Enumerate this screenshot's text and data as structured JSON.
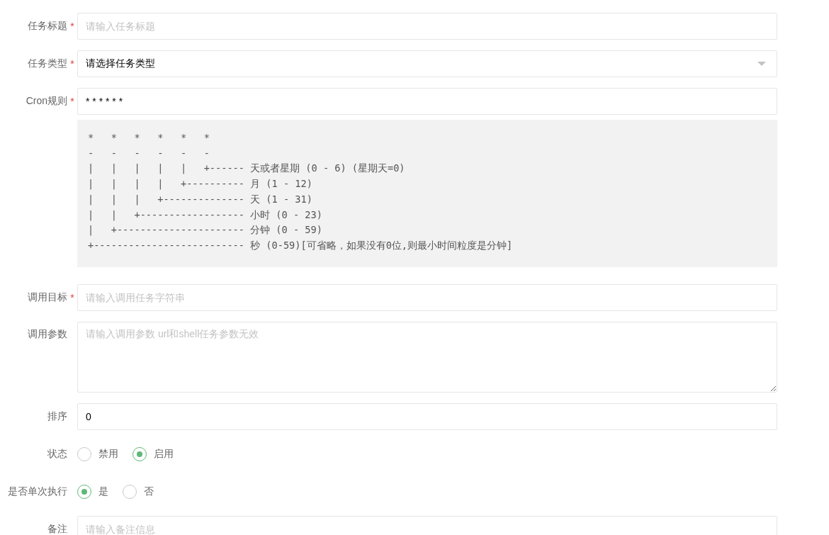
{
  "form": [
    {
      "kind": "input",
      "label": "任务标题",
      "required_mark": "*",
      "placeholder": "请输入任务标题"
    },
    {
      "kind": "select",
      "label": "任务类型",
      "required_mark": "*",
      "value": "请选择任务类型"
    },
    {
      "kind": "input",
      "label": "Cron规则",
      "required_mark": "*",
      "value": "* * * * * *",
      "help": [
        "*   *   *   *   *   *",
        "-   -   -   -   -   -",
        "|   |   |   |   |   +------ 天或者星期 (0 - 6) (星期天=0)",
        "|   |   |   |   +---------- 月 (1 - 12)",
        "|   |   |   +-------------- 天 (1 - 31)",
        "|   |   +------------------ 小时 (0 - 23)",
        "|   +---------------------- 分钟 (0 - 59)",
        "+-------------------------- 秒 (0-59)[可省略，如果没有0位,则最小时间粒度是分钟]"
      ]
    },
    {
      "kind": "input",
      "label": "调用目标",
      "required_mark": "*",
      "placeholder": "请输入调用任务字符串"
    },
    {
      "kind": "textarea",
      "label": "调用参数",
      "placeholder": "请输入调用参数 url和shell任务参数无效"
    },
    {
      "kind": "input",
      "label": "排序",
      "value": "0"
    },
    {
      "kind": "radio",
      "label": "状态",
      "options": [
        {
          "label": "禁用",
          "selected": false
        },
        {
          "label": "启用",
          "selected": true
        }
      ]
    },
    {
      "kind": "radio",
      "label": "是否单次执行",
      "options": [
        {
          "label": "是",
          "selected": true
        },
        {
          "label": "否",
          "selected": false
        }
      ]
    },
    {
      "kind": "input",
      "label": "备注",
      "placeholder": "请输入备注信息"
    }
  ]
}
